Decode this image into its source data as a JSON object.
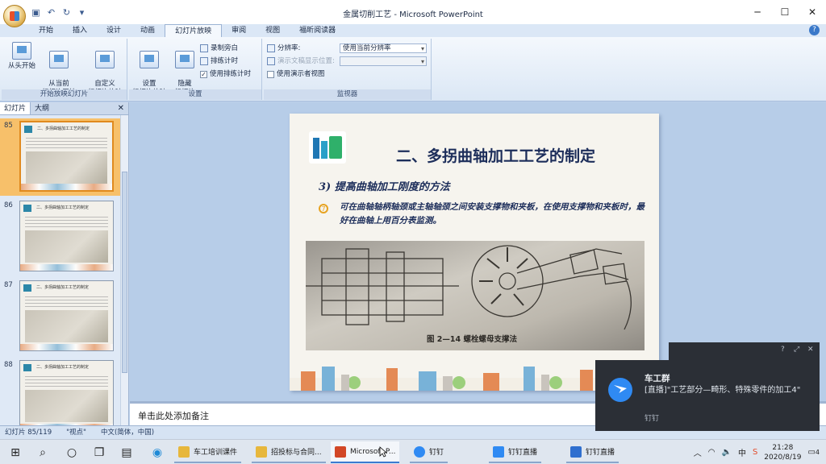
{
  "window": {
    "title": "金属切削工艺 - Microsoft PowerPoint"
  },
  "ribbon_tabs": [
    "开始",
    "插入",
    "设计",
    "动画",
    "幻灯片放映",
    "审阅",
    "视图",
    "福昕阅读器"
  ],
  "active_tab": "幻灯片放映",
  "ribbon": {
    "groups": {
      "start": {
        "label": "开始放映幻灯片",
        "from_beginning": "从头开始",
        "from_current": "从当前\n幻灯片开始",
        "custom": "自定义\n幻灯片放映"
      },
      "setup": {
        "label": "设置",
        "setup_show": "设置\n幻灯片放映",
        "hide_slide": "隐藏\n幻灯片",
        "record_narration": "录制旁白",
        "rehearse": "排练计时",
        "use_timings": "使用排练计时"
      },
      "monitors": {
        "label": "监视器",
        "resolution_label": "分辨率:",
        "resolution_value": "使用当前分辨率",
        "show_on_label": "演示文稿显示位置:",
        "presenter_view": "使用演示者视图"
      }
    }
  },
  "left_pane": {
    "tabs": [
      "幻灯片",
      "大纲"
    ],
    "close": "✕",
    "slides": [
      {
        "num": "85",
        "title": "二、多拐曲轴加工工艺的制定",
        "selected": true
      },
      {
        "num": "86",
        "title": "二、多拐曲轴加工工艺的制定",
        "selected": false
      },
      {
        "num": "87",
        "title": "二、多拐曲轴加工工艺的制定",
        "selected": false
      },
      {
        "num": "88",
        "title": "二、多拐曲轴加工工艺的制定",
        "selected": false
      }
    ]
  },
  "slide": {
    "title": "二、多拐曲轴加工工艺的制定",
    "subtitle": "3) 提高曲轴加工刚度的方法",
    "bullet_mark": "7",
    "body": "可在曲轴轴柄轴颈或主轴轴颈之间安装支撑物和夹板，在使用支撑物和夹板时，最好在曲轴上用百分表监测。",
    "photo_caption": "图 2—14    螺栓螺母支撑法"
  },
  "notes": {
    "placeholder": "单击此处添加备注"
  },
  "status_bar": {
    "slide_info": "幻灯片 85/119",
    "theme": "\"视点\"",
    "language": "中文(简体，中国)"
  },
  "taskbar": {
    "apps": [
      {
        "label": "车工培训课件",
        "icon": "folder-icon",
        "color": "#e7b73c"
      },
      {
        "label": "招投标与合同...",
        "icon": "folder-icon",
        "color": "#e7b73c"
      },
      {
        "label": "Microsoft P...",
        "icon": "powerpoint-icon",
        "color": "#d24726"
      },
      {
        "label": "钉钉",
        "icon": "dingtalk-icon",
        "color": "#2f8af3"
      },
      {
        "label": "钉钉直播",
        "icon": "live-icon",
        "color": "#2f8af3"
      },
      {
        "label": "钉钉直播",
        "icon": "live-window-icon",
        "color": "#2f6fcf"
      }
    ],
    "time": "21:28",
    "date": "2020/8/19",
    "ime": "中",
    "notification_count": "4"
  },
  "toast": {
    "title": "车工群",
    "message": "[直播]\"工艺部分—畸形、特殊零件的加工4\"",
    "source": "钉钉"
  },
  "colors": {
    "accent": "#3b7bd0",
    "selected_thumb": "#f7c06a",
    "slide_title": "#1c2d5a"
  }
}
